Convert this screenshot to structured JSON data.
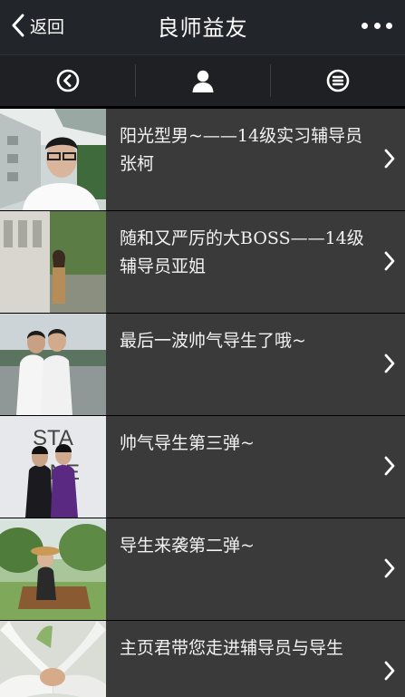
{
  "header": {
    "back_label": "返回",
    "title": "良师益友",
    "back_icon": "chevron-left-icon",
    "more_icon": "more-dots-icon"
  },
  "toolbar": {
    "icons": [
      "back-circle-icon",
      "user-icon",
      "list-menu-icon"
    ]
  },
  "articles": [
    {
      "title": "阳光型男~——14级实习辅导员张柯",
      "thumbnail": "photo-young-man-glasses"
    },
    {
      "title": "随和又严厉的大BOSS——14级辅导员亚姐",
      "thumbnail": "photo-woman-campus"
    },
    {
      "title": "最后一波帅气导生了哦~",
      "thumbnail": "photo-two-students"
    },
    {
      "title": "帅气导生第三弹~",
      "thumbnail": "photo-stage-students"
    },
    {
      "title": "导生来袭第二弹~",
      "thumbnail": "photo-girl-hat-park"
    },
    {
      "title": "主页君带您走进辅导员与导生",
      "thumbnail": "photo-hands-together"
    }
  ],
  "colors": {
    "titlebar": "#222529",
    "toolbar": "#1e2023",
    "item_bg": "#3a3a3a",
    "text": "#f2f2f2"
  }
}
